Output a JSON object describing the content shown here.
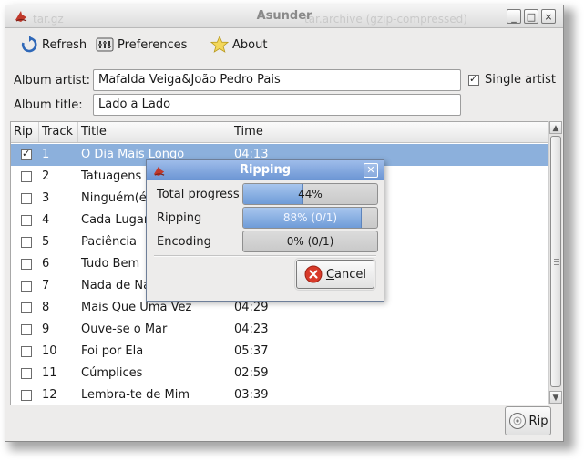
{
  "window": {
    "title": "Asunder",
    "bg_text_left": "tar.gz",
    "bg_text_right": "tar.archive (gzip-compressed)",
    "controls": [
      "_",
      "□",
      "×"
    ]
  },
  "toolbar": {
    "refresh_label": "Refresh",
    "preferences_label": "Preferences",
    "about_label": "About"
  },
  "form": {
    "album_artist_label": "Album artist:",
    "album_artist_value": "Mafalda Veiga&João Pedro Pais",
    "single_artist_label": "Single artist",
    "single_artist_checked": true,
    "album_title_label": "Album title:",
    "album_title_value": "Lado a Lado"
  },
  "tracklist": {
    "columns": [
      "Rip",
      "Track",
      "Title",
      "Time"
    ],
    "rows": [
      {
        "rip": true,
        "track": "1",
        "title": "O Dia Mais Longo",
        "time": "04:13"
      },
      {
        "rip": false,
        "track": "2",
        "title": "Tatuagens",
        "time": ""
      },
      {
        "rip": false,
        "track": "3",
        "title": "Ninguém(é",
        "time": ""
      },
      {
        "rip": false,
        "track": "4",
        "title": "Cada Lugar",
        "time": ""
      },
      {
        "rip": false,
        "track": "5",
        "title": "Paciência",
        "time": ""
      },
      {
        "rip": false,
        "track": "6",
        "title": "Tudo Bem",
        "time": ""
      },
      {
        "rip": false,
        "track": "7",
        "title": "Nada de Na",
        "time": ""
      },
      {
        "rip": false,
        "track": "8",
        "title": "Mais Que Uma Vez",
        "time": "04:29"
      },
      {
        "rip": false,
        "track": "9",
        "title": "Ouve-se o Mar",
        "time": "04:23"
      },
      {
        "rip": false,
        "track": "10",
        "title": "Foi por Ela",
        "time": "05:37"
      },
      {
        "rip": false,
        "track": "11",
        "title": "Cúmplices",
        "time": "02:59"
      },
      {
        "rip": false,
        "track": "12",
        "title": "Lembra-te de Mim",
        "time": "03:39"
      }
    ]
  },
  "rip_button_label": "Rip",
  "dialog": {
    "title": "Ripping",
    "total_progress_label": "Total progress",
    "total_progress_text": "44%",
    "total_progress_value": 0.44,
    "ripping_label": "Ripping",
    "ripping_text": "88% (0/1)",
    "ripping_value": 0.88,
    "encoding_label": "Encoding",
    "encoding_text": "0% (0/1)",
    "encoding_value": 0.0,
    "cancel_label": "Cancel"
  },
  "colors": {
    "selection": "#8cb0dc",
    "dialog_titlebar": "#7aa0da",
    "progress_fill": "#7ea7de"
  }
}
